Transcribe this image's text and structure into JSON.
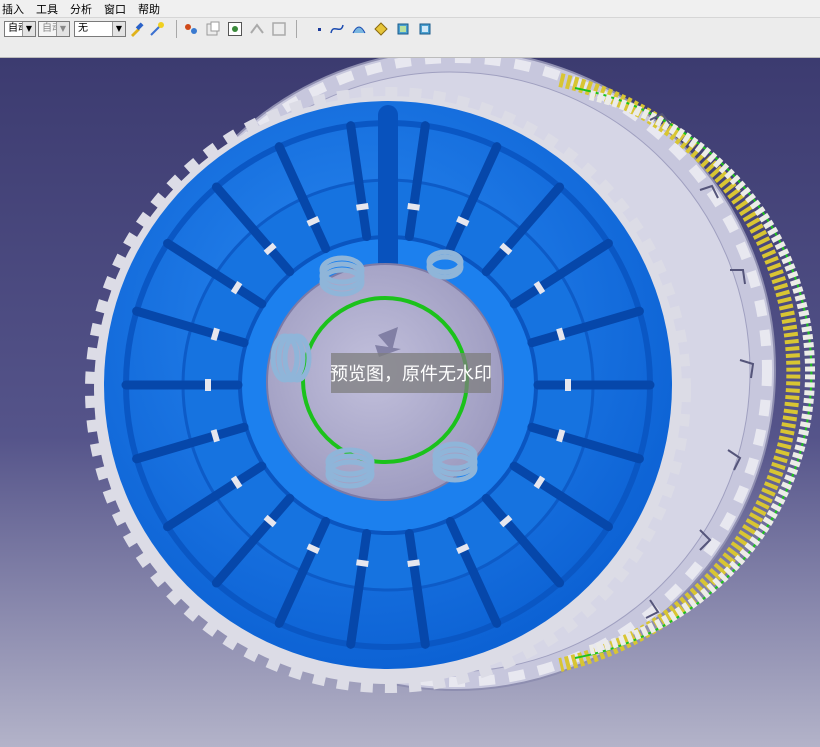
{
  "menu": {
    "items": [
      "插入",
      "工具",
      "分析",
      "窗口",
      "帮助"
    ]
  },
  "toolbar": {
    "combo_1": "自动",
    "combo_2": "自动",
    "combo_3": "无"
  },
  "viewport": {
    "watermark": "预览图，原件无水印"
  },
  "colors": {
    "background_top": "#3c3b70",
    "background_bottom": "#b3b3c9",
    "part_blue": "#0e6fe6",
    "outer_ring": "#c9c9df",
    "spring_steel": "#8fb5d9",
    "green_ring": "#1bc21b",
    "yellow_plates": "#d8c533"
  }
}
